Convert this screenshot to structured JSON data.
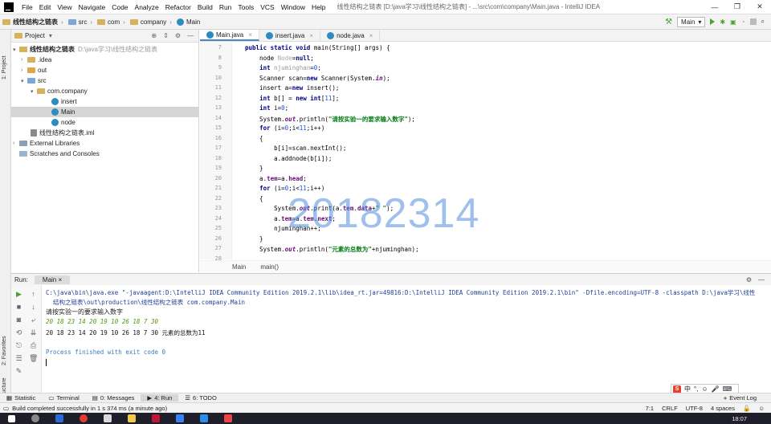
{
  "menu": {
    "items": [
      "File",
      "Edit",
      "View",
      "Navigate",
      "Code",
      "Analyze",
      "Refactor",
      "Build",
      "Run",
      "Tools",
      "VCS",
      "Window",
      "Help"
    ],
    "window_title": "线性结构之链表 [D:\\java学习\\线性结构之链表] - ...\\src\\com\\company\\Main.java - IntelliJ IDEA"
  },
  "navbar": {
    "breadcrumbs": [
      "线性结构之链表",
      "src",
      "com",
      "company",
      "Main"
    ],
    "run_config": "Main"
  },
  "left_strip": {
    "project_tab": "1: Project",
    "favorites_tab": "2: Favorites",
    "structure_tab": "Z: Structure"
  },
  "project": {
    "header": "Project",
    "tree": [
      {
        "label": "线性结构之链表",
        "hint": "D:\\java学习\\线性结构之链表",
        "bold": true
      },
      {
        "label": ".idea"
      },
      {
        "label": "out"
      },
      {
        "label": "src"
      },
      {
        "label": "com.company"
      },
      {
        "label": "insert"
      },
      {
        "label": "Main"
      },
      {
        "label": "node"
      },
      {
        "label": "线性结构之链表.iml"
      },
      {
        "label": "External Libraries"
      },
      {
        "label": "Scratches and Consoles"
      }
    ]
  },
  "editor": {
    "tabs": [
      "Main.java",
      "insert.java",
      "node.java"
    ],
    "line_numbers": [
      "7",
      "8",
      "9",
      "10",
      "11",
      "12",
      "13",
      "14",
      "15",
      "16",
      "17",
      "18",
      "19",
      "20",
      "21",
      "22",
      "23",
      "24",
      "25",
      "26",
      "27",
      "28"
    ],
    "breadcrumb": [
      "Main",
      "main()"
    ],
    "watermark": "20182314"
  },
  "run": {
    "label": "Run:",
    "tab": "Main",
    "output": {
      "cmd1": "C:\\java\\bin\\java.exe \"-javaagent:D:\\IntelliJ IDEA Community Edition 2019.2.1\\lib\\idea_rt.jar=49816:D:\\IntelliJ IDEA Community Edition 2019.2.1\\bin\" -Dfile.encoding=UTF-8 -classpath D:\\java学习\\线性",
      "cmd2": "  结构之链表\\out\\production\\线性结构之链表 com.company.Main",
      "prompt": "请按实验一的要求输入数字",
      "input": "20 18 23 14 20 19 10 26 18 7 30",
      "result": "20 18 23 14 20 19 10 26 18 7 30 元素的总数为11",
      "exit": "Process finished with exit code 0"
    }
  },
  "bottom_tabs": [
    "Statistic",
    "Terminal",
    "0: Messages",
    "4: Run",
    "6: TODO"
  ],
  "event_log": "Event Log",
  "status": {
    "message": "Build completed successfully in 1 s 374 ms (a minute ago)",
    "position": "7:1",
    "line_sep": "CRLF",
    "encoding": "UTF-8",
    "indent": "4 spaces"
  },
  "ime": {
    "label": "中"
  },
  "taskbar": {
    "clock": "18:07"
  }
}
